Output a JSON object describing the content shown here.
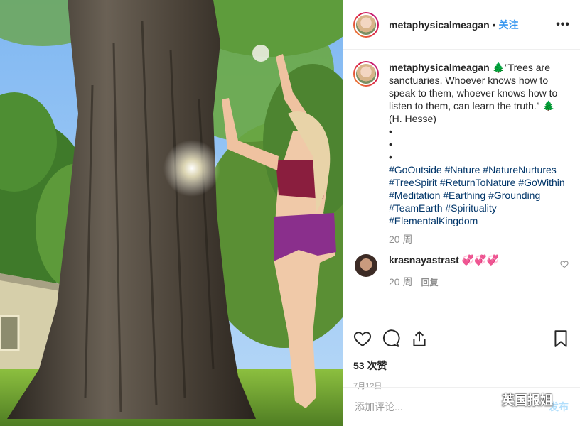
{
  "post": {
    "username": "metaphysicalmeagan",
    "separator": "•",
    "follow_label": "关注",
    "more_label": "•••"
  },
  "caption": {
    "username": "metaphysicalmeagan",
    "text": " 🌲”Trees are sanctuaries. Whoever knows how to speak to them, whoever knows how to listen to them, can learn the truth.” 🌲(H. Hesse)",
    "bullets": [
      "•",
      "•",
      "•"
    ],
    "hashtags": "#GoOutside #Nature #NatureNurtures #TreeSpirit #ReturnToNature #GoWithin #Meditation #Earthing #Grounding #TeamEarth #Spirituality #ElementalKingdom",
    "age": "20 周"
  },
  "comment": {
    "username": "krasnayastrast",
    "text": " 💞💞💞",
    "age": "20 周",
    "reply_label": "回复",
    "heart_icon": "heart-outline-icon"
  },
  "actions": {
    "like_icon": "heart-icon",
    "comment_icon": "comment-icon",
    "share_icon": "share-icon",
    "save_icon": "bookmark-icon",
    "likes": "53 次赞",
    "date": "7月12日"
  },
  "add_comment": {
    "placeholder": "添加评论...",
    "post_label": "发布"
  },
  "watermark": {
    "text": "英国报姐"
  },
  "colors": {
    "link": "#003569",
    "follow": "#3897f0",
    "muted": "#8e8e8e"
  }
}
